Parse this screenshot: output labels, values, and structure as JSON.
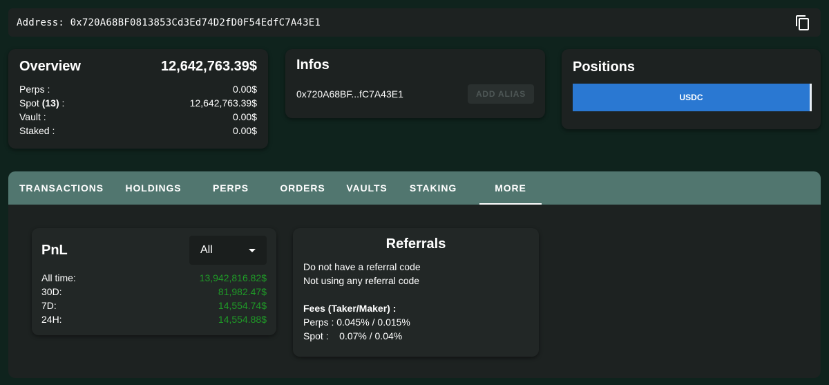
{
  "address": {
    "label": "Address: 0x720A68BF0813853Cd3Ed74D2fD0F54EdfC7A43E1",
    "copy_icon": "copy-icon"
  },
  "overview": {
    "title": "Overview",
    "total": "12,642,763.39$",
    "rows": [
      {
        "label": "Perps :",
        "value": "0.00$"
      },
      {
        "label_prefix": "Spot ",
        "label_count": "(13)",
        "label_suffix": " :",
        "value": "12,642,763.39$"
      },
      {
        "label": "Vault :",
        "value": "0.00$"
      },
      {
        "label": "Staked :",
        "value": "0.00$"
      }
    ]
  },
  "infos": {
    "title": "Infos",
    "short_address": "0x720A68BF...fC7A43E1",
    "alias_button": "ADD ALIAS"
  },
  "positions": {
    "title": "Positions",
    "bar_label": "USDC",
    "bar_color": "#2a78d2"
  },
  "tabs": [
    {
      "label": "TRANSACTIONS",
      "active": false
    },
    {
      "label": "HOLDINGS",
      "active": false
    },
    {
      "label": "PERPS",
      "active": false
    },
    {
      "label": "ORDERS",
      "active": false
    },
    {
      "label": "VAULTS",
      "active": false
    },
    {
      "label": "STAKING",
      "active": false
    },
    {
      "label": "MORE",
      "active": true
    }
  ],
  "pnl": {
    "title": "PnL",
    "select_value": "All",
    "rows": [
      {
        "label": "All time:",
        "value": "13,942,816.82$"
      },
      {
        "label": "30D:",
        "value": "81,982.47$"
      },
      {
        "label": "7D:",
        "value": "14,554.74$"
      },
      {
        "label": "24H:",
        "value": "14,554.88$"
      }
    ],
    "value_color": "#1f9a27"
  },
  "referrals": {
    "title": "Referrals",
    "line1": "Do not have a referral code",
    "line2": "Not using any referral code",
    "fees_heading": "Fees (Taker/Maker) :",
    "perps_label": "Perps : ",
    "perps_value": "0.045% / 0.015%",
    "spot_label": "Spot :",
    "spot_value": "0.07% / 0.04%"
  },
  "colors": {
    "background": "#0f231d",
    "card": "#1d2221",
    "tabs_bar": "#51766f"
  }
}
